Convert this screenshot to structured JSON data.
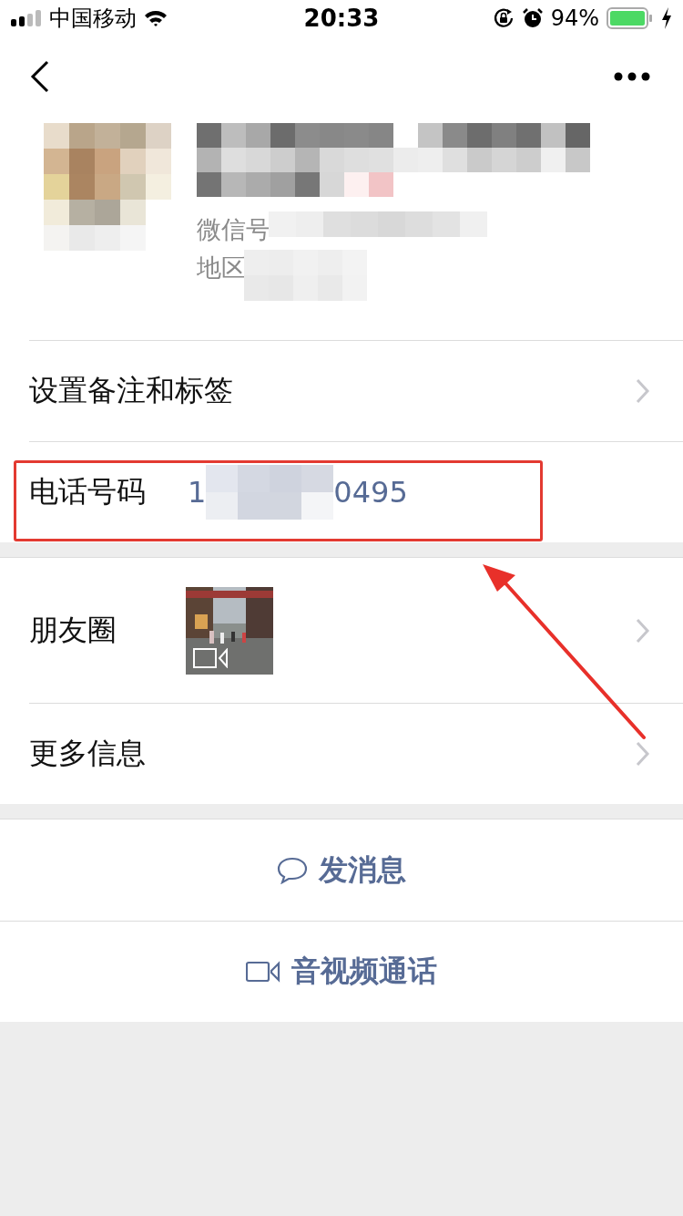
{
  "status_bar": {
    "carrier": "中国移动",
    "time": "20:33",
    "battery": "94%",
    "charging": true
  },
  "profile": {
    "wechat_id_label": "微信号",
    "region_label": "地区"
  },
  "sections": [
    {
      "rows": [
        {
          "kind": "link",
          "label": "设置备注和标签"
        },
        {
          "kind": "phone",
          "label": "电话号码",
          "value_start": "1",
          "value_end": "0495",
          "highlighted": true
        }
      ]
    },
    {
      "rows": [
        {
          "kind": "moments",
          "label": "朋友圈",
          "video": true
        },
        {
          "kind": "link",
          "label": "更多信息"
        }
      ]
    }
  ],
  "actions": [
    {
      "kind": "message",
      "label": "发消息"
    },
    {
      "kind": "video_call",
      "label": "音视频通话"
    }
  ]
}
